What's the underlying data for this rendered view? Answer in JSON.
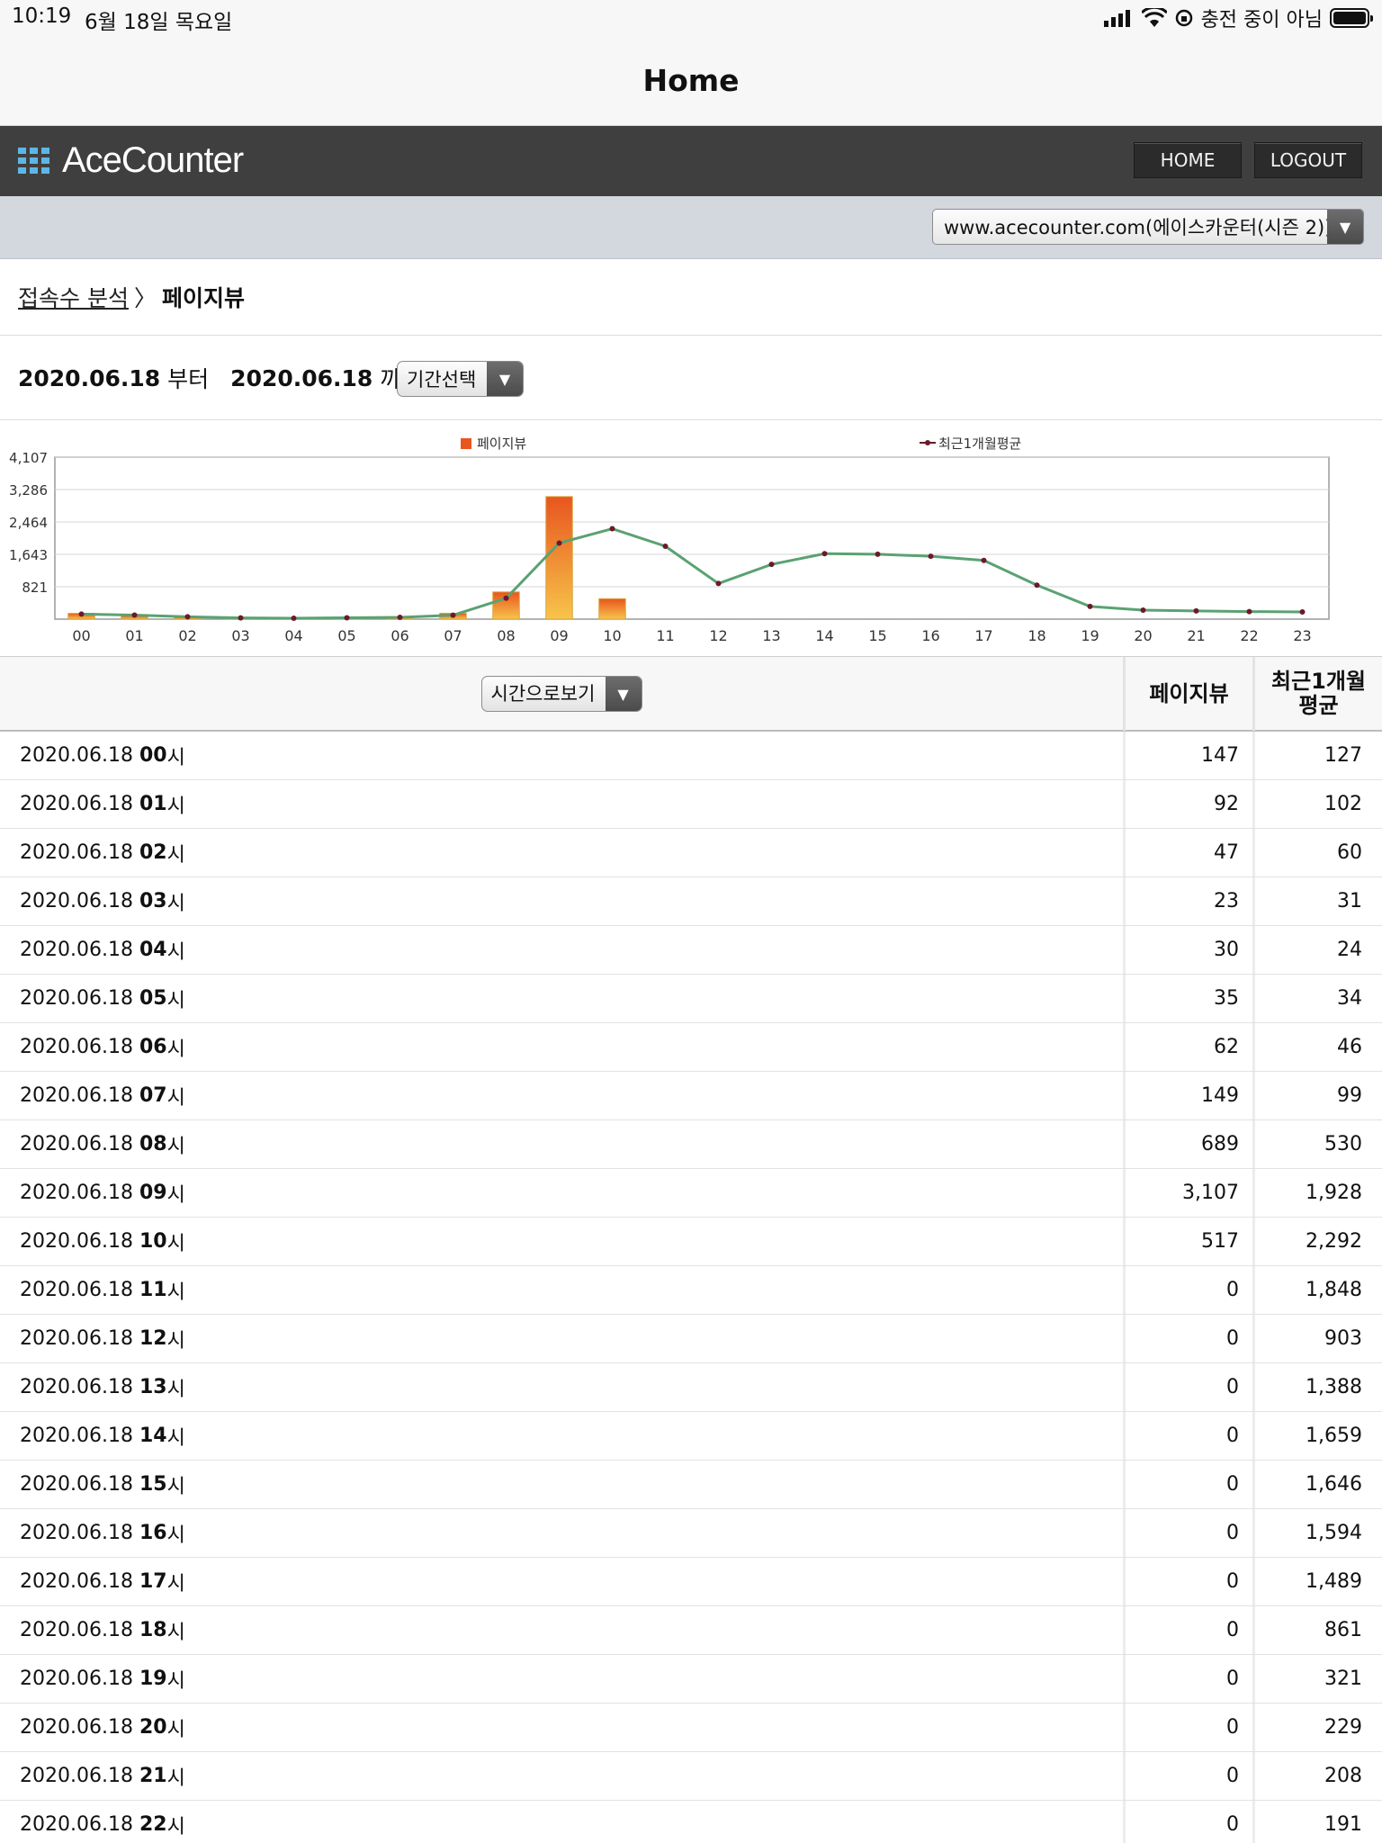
{
  "status_bar": {
    "time": "10:19",
    "date": "6월 18일 목요일",
    "charging": "충전 중이 아님",
    "icons": [
      "signal-icon",
      "wifi-icon",
      "orientation-lock-icon",
      "battery-icon"
    ]
  },
  "nav": {
    "title": "Home"
  },
  "header": {
    "logo_text": "AceCounter",
    "home_label": "HOME",
    "logout_label": "LOGOUT"
  },
  "site": {
    "selected": "www.acecounter.com(에이스카운터(시즌 2))"
  },
  "breadcrumb": {
    "parent": "접속수 분석",
    "separator": "〉",
    "current": "페이지뷰"
  },
  "period": {
    "start": "2020.06.18",
    "start_suffix": "부터",
    "end": "2020.06.18",
    "end_suffix": "까지",
    "select_label": "기간선택"
  },
  "chart_data": {
    "type": "bar",
    "categories": [
      "00",
      "01",
      "02",
      "03",
      "04",
      "05",
      "06",
      "07",
      "08",
      "09",
      "10",
      "11",
      "12",
      "13",
      "14",
      "15",
      "16",
      "17",
      "18",
      "19",
      "20",
      "21",
      "22",
      "23"
    ],
    "series": [
      {
        "name": "페이지뷰",
        "type": "bar",
        "values": [
          147,
          92,
          47,
          23,
          30,
          35,
          62,
          149,
          689,
          3107,
          517,
          0,
          0,
          0,
          0,
          0,
          0,
          0,
          0,
          0,
          0,
          0,
          0,
          0
        ]
      },
      {
        "name": "최근1개월평균",
        "type": "line",
        "values": [
          127,
          102,
          60,
          31,
          24,
          34,
          46,
          99,
          530,
          1928,
          2292,
          1848,
          903,
          1388,
          1659,
          1646,
          1594,
          1489,
          861,
          321,
          229,
          208,
          191,
          182
        ]
      }
    ],
    "yticks": [
      "4,107",
      "3,286",
      "2,464",
      "1,643",
      "821"
    ],
    "ylim": [
      0,
      4107
    ],
    "grid": true,
    "legend": "top",
    "colors": {
      "bar_top": "#e8551f",
      "bar_bottom": "#f7c44a",
      "line": "#5aa272",
      "marker": "#6b1a2a"
    }
  },
  "table": {
    "view_select_label": "시간으로보기",
    "col_pageview": "페이지뷰",
    "col_avg": "최근1개월\n평균",
    "hour_suffix": "시",
    "rows": [
      {
        "date": "2020.06.18",
        "hour": "00",
        "pv": "147",
        "avg": "127"
      },
      {
        "date": "2020.06.18",
        "hour": "01",
        "pv": "92",
        "avg": "102"
      },
      {
        "date": "2020.06.18",
        "hour": "02",
        "pv": "47",
        "avg": "60"
      },
      {
        "date": "2020.06.18",
        "hour": "03",
        "pv": "23",
        "avg": "31"
      },
      {
        "date": "2020.06.18",
        "hour": "04",
        "pv": "30",
        "avg": "24"
      },
      {
        "date": "2020.06.18",
        "hour": "05",
        "pv": "35",
        "avg": "34"
      },
      {
        "date": "2020.06.18",
        "hour": "06",
        "pv": "62",
        "avg": "46"
      },
      {
        "date": "2020.06.18",
        "hour": "07",
        "pv": "149",
        "avg": "99"
      },
      {
        "date": "2020.06.18",
        "hour": "08",
        "pv": "689",
        "avg": "530"
      },
      {
        "date": "2020.06.18",
        "hour": "09",
        "pv": "3,107",
        "avg": "1,928"
      },
      {
        "date": "2020.06.18",
        "hour": "10",
        "pv": "517",
        "avg": "2,292"
      },
      {
        "date": "2020.06.18",
        "hour": "11",
        "pv": "0",
        "avg": "1,848"
      },
      {
        "date": "2020.06.18",
        "hour": "12",
        "pv": "0",
        "avg": "903"
      },
      {
        "date": "2020.06.18",
        "hour": "13",
        "pv": "0",
        "avg": "1,388"
      },
      {
        "date": "2020.06.18",
        "hour": "14",
        "pv": "0",
        "avg": "1,659"
      },
      {
        "date": "2020.06.18",
        "hour": "15",
        "pv": "0",
        "avg": "1,646"
      },
      {
        "date": "2020.06.18",
        "hour": "16",
        "pv": "0",
        "avg": "1,594"
      },
      {
        "date": "2020.06.18",
        "hour": "17",
        "pv": "0",
        "avg": "1,489"
      },
      {
        "date": "2020.06.18",
        "hour": "18",
        "pv": "0",
        "avg": "861"
      },
      {
        "date": "2020.06.18",
        "hour": "19",
        "pv": "0",
        "avg": "321"
      },
      {
        "date": "2020.06.18",
        "hour": "20",
        "pv": "0",
        "avg": "229"
      },
      {
        "date": "2020.06.18",
        "hour": "21",
        "pv": "0",
        "avg": "208"
      },
      {
        "date": "2020.06.18",
        "hour": "22",
        "pv": "0",
        "avg": "191"
      }
    ]
  }
}
